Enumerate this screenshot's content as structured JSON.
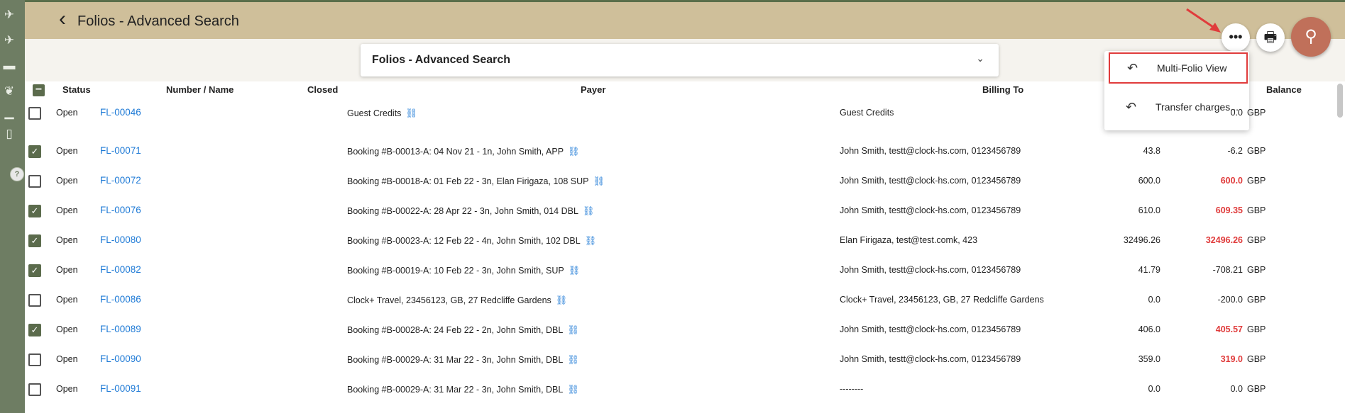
{
  "header": {
    "title": "Folios - Advanced Search"
  },
  "search_panel": {
    "title": "Folios - Advanced Search"
  },
  "menu": {
    "items": [
      {
        "label": "Multi-Folio View"
      },
      {
        "label": "Transfer charges..."
      }
    ]
  },
  "table": {
    "columns": [
      "Status",
      "Number / Name",
      "Closed",
      "Payer",
      "Billing To",
      "Balance"
    ],
    "rows": [
      {
        "checked": false,
        "status": "Open",
        "number": "FL-00046",
        "payer": "Guest Credits",
        "billing": "Guest Credits",
        "amount": "",
        "balance": "0.0",
        "currency": "GBP",
        "balance_red": false
      },
      {
        "checked": true,
        "status": "Open",
        "number": "FL-00071",
        "payer": "Booking #B-00013-A: 04 Nov 21 - 1n, John Smith, APP",
        "billing": "John Smith, testt@clock-hs.com, 0123456789",
        "amount": "43.8",
        "balance": "-6.2",
        "currency": "GBP",
        "balance_red": false
      },
      {
        "checked": false,
        "status": "Open",
        "number": "FL-00072",
        "payer": "Booking #B-00018-A: 01 Feb 22 - 3n, Elan Firigaza, 108 SUP",
        "billing": "John Smith, testt@clock-hs.com, 0123456789",
        "amount": "600.0",
        "balance": "600.0",
        "currency": "GBP",
        "balance_red": true
      },
      {
        "checked": true,
        "status": "Open",
        "number": "FL-00076",
        "payer": "Booking #B-00022-A: 28 Apr 22 - 3n, John Smith, 014 DBL",
        "billing": "John Smith, testt@clock-hs.com, 0123456789",
        "amount": "610.0",
        "balance": "609.35",
        "currency": "GBP",
        "balance_red": true
      },
      {
        "checked": true,
        "status": "Open",
        "number": "FL-00080",
        "payer": "Booking #B-00023-A: 12 Feb 22 - 4n, John Smith, 102 DBL",
        "billing": "Elan Firigaza, test@test.comk, 423",
        "amount": "32496.26",
        "balance": "32496.26",
        "currency": "GBP",
        "balance_red": true
      },
      {
        "checked": true,
        "status": "Open",
        "number": "FL-00082",
        "payer": "Booking #B-00019-A: 10 Feb 22 - 3n, John Smith, SUP",
        "billing": "John Smith, testt@clock-hs.com, 0123456789",
        "amount": "41.79",
        "balance": "-708.21",
        "currency": "GBP",
        "balance_red": false
      },
      {
        "checked": false,
        "status": "Open",
        "number": "FL-00086",
        "payer": "Clock+ Travel, 23456123, GB, 27 Redcliffe Gardens",
        "billing": "Clock+ Travel, 23456123, GB, 27 Redcliffe Gardens",
        "amount": "0.0",
        "balance": "-200.0",
        "currency": "GBP",
        "balance_red": false
      },
      {
        "checked": true,
        "status": "Open",
        "number": "FL-00089",
        "payer": "Booking #B-00028-A: 24 Feb 22 - 2n, John Smith, DBL",
        "billing": "John Smith, testt@clock-hs.com, 0123456789",
        "amount": "406.0",
        "balance": "405.57",
        "currency": "GBP",
        "balance_red": true
      },
      {
        "checked": false,
        "status": "Open",
        "number": "FL-00090",
        "payer": "Booking #B-00029-A: 31 Mar 22 - 3n, John Smith, DBL",
        "billing": "John Smith, testt@clock-hs.com, 0123456789",
        "amount": "359.0",
        "balance": "319.0",
        "currency": "GBP",
        "balance_red": true
      },
      {
        "checked": false,
        "status": "Open",
        "number": "FL-00091",
        "payer": "Booking #B-00029-A: 31 Mar 22 - 3n, John Smith, DBL",
        "billing": "--------",
        "amount": "0.0",
        "balance": "0.0",
        "currency": "GBP",
        "balance_red": false
      }
    ]
  },
  "colors": {
    "header_bg": "#cfbf9a",
    "rail_bg": "#6e7d63",
    "checkbox_on": "#5b6b4c",
    "link": "#1e7ad6",
    "negative": "#e03c3c",
    "search_fab": "#c0705a"
  }
}
